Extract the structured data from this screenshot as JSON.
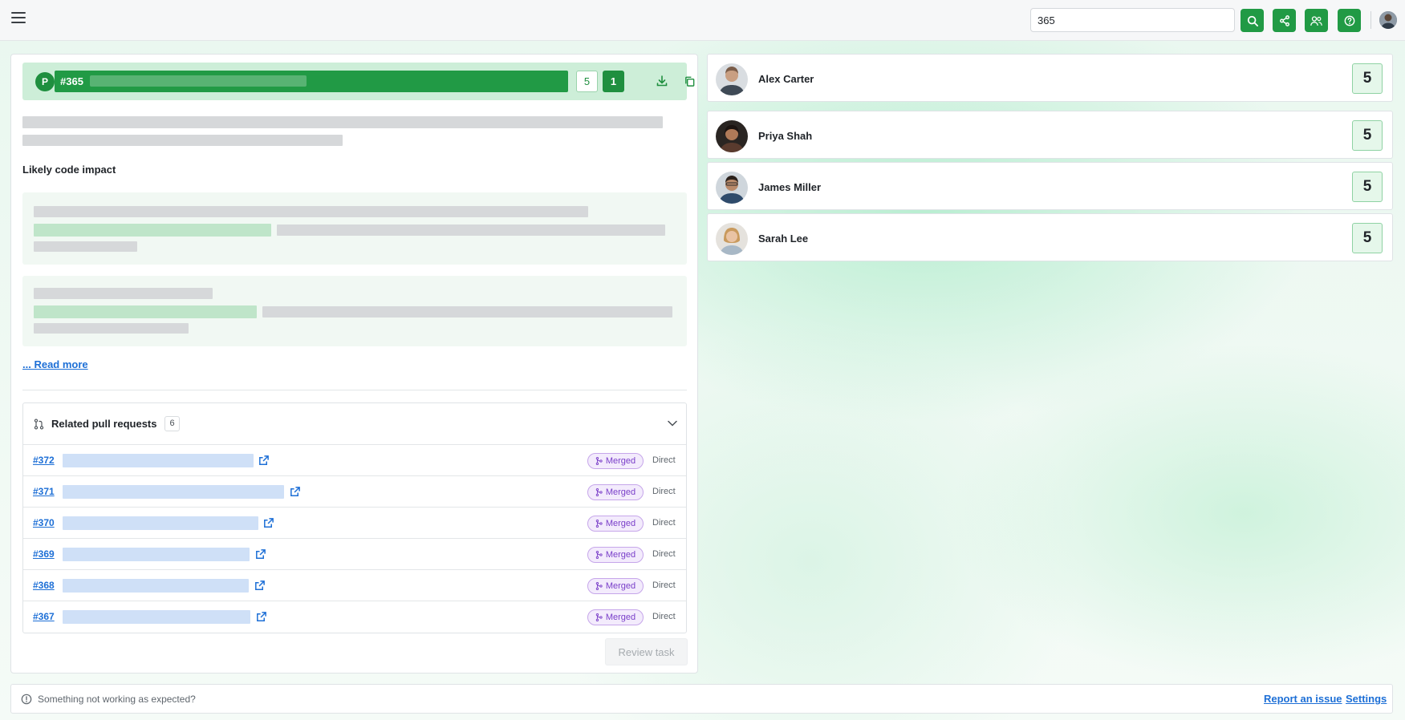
{
  "header": {
    "search": {
      "value": "365"
    },
    "icons": [
      "menu-icon",
      "search-icon",
      "share-icon",
      "team-icon",
      "help-icon"
    ],
    "accent_color": "#219a45"
  },
  "task": {
    "badge": "P",
    "id": "#365",
    "count_outline": "5",
    "count_filled": "1",
    "section_title": "Likely code impact",
    "read_more": "... Read more"
  },
  "pull_requests": {
    "title": "Related pull requests",
    "count": "6",
    "rows": [
      {
        "id": "#372",
        "status": "Merged",
        "relation": "Direct"
      },
      {
        "id": "#371",
        "status": "Merged",
        "relation": "Direct"
      },
      {
        "id": "#370",
        "status": "Merged",
        "relation": "Direct"
      },
      {
        "id": "#369",
        "status": "Merged",
        "relation": "Direct"
      },
      {
        "id": "#368",
        "status": "Merged",
        "relation": "Direct"
      },
      {
        "id": "#367",
        "status": "Merged",
        "relation": "Direct"
      }
    ],
    "status_color": "#7a3fc9"
  },
  "review_button": "Review task",
  "people": [
    {
      "name": "Alex Carter",
      "score": "5"
    },
    {
      "name": "Priya Shah",
      "score": "5"
    },
    {
      "name": "James Miller",
      "score": "5"
    },
    {
      "name": "Sarah Lee",
      "score": "5"
    }
  ],
  "footer": {
    "message": "Something not working as expected?",
    "report_link": "Report an issue",
    "settings_link": "Settings"
  }
}
